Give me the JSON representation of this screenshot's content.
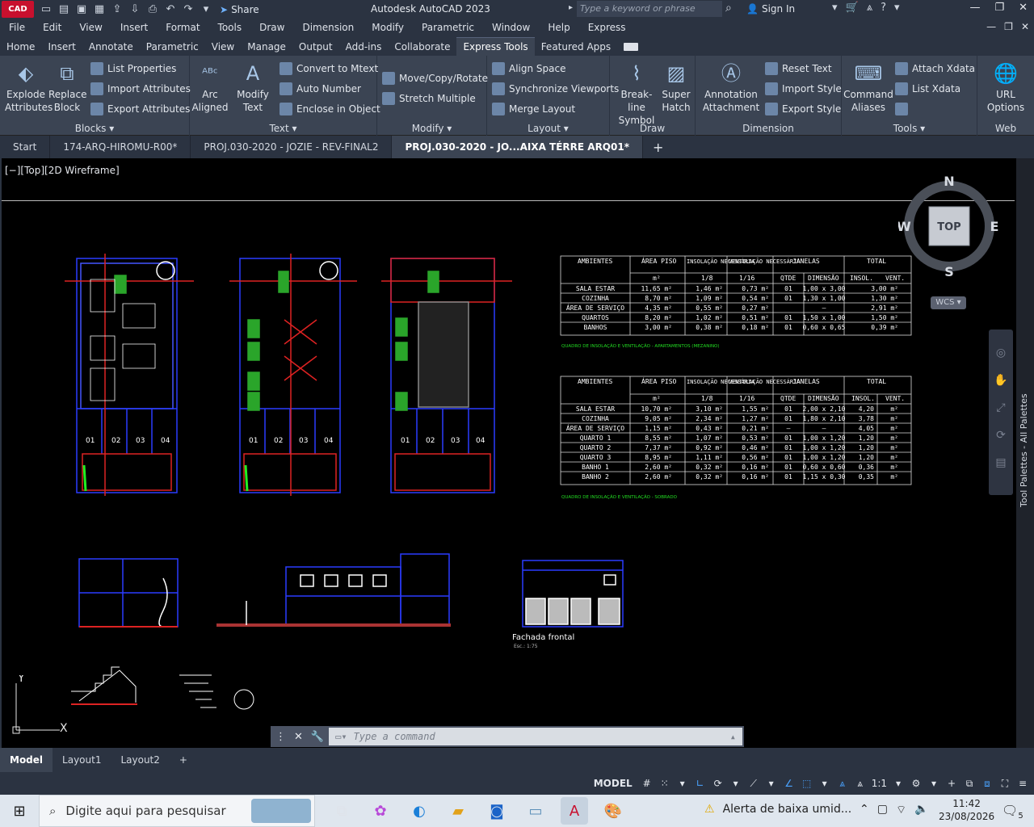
{
  "titlebar": {
    "app_badge": "CAD",
    "share_label": "Share",
    "title": "Autodesk AutoCAD 2023",
    "search_placeholder": "Type a keyword or phrase",
    "sign_in": "Sign In"
  },
  "menu": [
    "File",
    "Edit",
    "View",
    "Insert",
    "Format",
    "Tools",
    "Draw",
    "Dimension",
    "Modify",
    "Parametric",
    "Window",
    "Help",
    "Express"
  ],
  "ribbon_tabs": [
    "Home",
    "Insert",
    "Annotate",
    "Parametric",
    "View",
    "Manage",
    "Output",
    "Add-ins",
    "Collaborate",
    "Express Tools",
    "Featured Apps"
  ],
  "ribbon": {
    "blocks": {
      "title": "Blocks",
      "explode": "Explode Attributes",
      "replace": "Replace Block",
      "list_props": "List Properties",
      "import_attr": "Import Attributes",
      "export_attr": "Export Attributes"
    },
    "text": {
      "title": "Text",
      "arc": "Arc Aligned",
      "modify": "Modify Text",
      "convert": "Convert to Mtext",
      "autonum": "Auto Number",
      "enclose": "Enclose in Object"
    },
    "modify": {
      "title": "Modify",
      "move": "Move/Copy/Rotate",
      "stretch": "Stretch Multiple"
    },
    "layout": {
      "title": "Layout",
      "align": "Align Space",
      "sync": "Synchronize Viewports",
      "merge": "Merge Layout"
    },
    "draw": {
      "title": "Draw",
      "breakline": "Break-line Symbol",
      "superhatch": "Super Hatch"
    },
    "dimension": {
      "title": "Dimension",
      "annotation": "Annotation Attachment",
      "reset": "Reset Text",
      "import_style": "Import Style",
      "export_style": "Export Style"
    },
    "tools": {
      "title": "Tools",
      "command": "Command Aliases",
      "attach": "Attach Xdata",
      "list": "List Xdata"
    },
    "web": {
      "title": "Web",
      "url": "URL Options"
    }
  },
  "doc_tabs": [
    "Start",
    "174-ARQ-HIROMU-R00*",
    "PROJ.030-2020 - JOZIE - REV-FINAL2",
    "PROJ.030-2020 - JO...AIXA TÉRRE ARQ01*"
  ],
  "viewport_label": "[−][Top][2D Wireframe]",
  "viewcube": {
    "n": "N",
    "s": "S",
    "e": "E",
    "w": "W",
    "face": "TOP",
    "wcs": "WCS"
  },
  "tool_palettes": "Tool Palettes - All Palettes",
  "table1": {
    "headers": [
      "AMBIENTES",
      "ÁREA PISO",
      "INSOLAÇÃO NECESSÁRIA",
      "VENTILAÇÃO NECESSÁRIA",
      "JANELAS",
      "TOTAL"
    ],
    "sub": [
      "m²",
      "1/8",
      "1/16",
      "QTDE",
      "DIMENSÃO",
      "INSOL.",
      "VENT."
    ],
    "rows": [
      [
        "SALA ESTAR",
        "11,65 m²",
        "1,46 m²",
        "0,73 m²",
        "01",
        "1,00 x 3,00",
        "3,00 m²"
      ],
      [
        "COZINHA",
        "8,70 m²",
        "1,09 m²",
        "0,54 m²",
        "01",
        "1,30 x 1,00",
        "1,30 m²"
      ],
      [
        "ÁREA DE SERVIÇO",
        "4,35 m²",
        "0,55 m²",
        "0,27 m²",
        "",
        "–",
        "2,91 m²"
      ],
      [
        "QUARTOS",
        "8,20 m²",
        "1,02 m²",
        "0,51 m²",
        "01",
        "1,50 x 1,00",
        "1,50 m²"
      ],
      [
        "BANHOS",
        "3,00 m²",
        "0,38 m²",
        "0,18 m²",
        "01",
        "0,60 x 0,65",
        "0,39 m²"
      ]
    ],
    "caption": "QUADRO DE INSOLAÇÃO E VENTILAÇÃO - APARTAMENTOS (MEZANINO)"
  },
  "table2": {
    "headers": [
      "AMBIENTES",
      "ÁREA PISO",
      "INSOLAÇÃO NECESSÁRIA",
      "VENTILAÇÃO NECESSÁRIA",
      "JANELAS",
      "TOTAL"
    ],
    "sub": [
      "m²",
      "1/8",
      "1/16",
      "QTDE",
      "DIMENSÃO",
      "INSOL.",
      "VENT."
    ],
    "rows": [
      [
        "SALA ESTAR",
        "10,70 m²",
        "3,10 m²",
        "1,55 m²",
        "01",
        "2,00 x 2,10",
        "4,20",
        "m²"
      ],
      [
        "COZINHA",
        "9,05 m²",
        "2,34 m²",
        "1,27 m²",
        "01",
        "1,80 x 2,10",
        "3,78",
        "m²"
      ],
      [
        "ÁREA DE SERVIÇO",
        "1,15 m²",
        "0,43 m²",
        "0,21 m²",
        "–",
        "–",
        "4,05",
        "m²"
      ],
      [
        "QUARTO 1",
        "8,55 m²",
        "1,07 m²",
        "0,53 m²",
        "01",
        "1,00 x 1,20",
        "1,20",
        "m²"
      ],
      [
        "QUARTO 2",
        "7,37 m²",
        "0,92 m²",
        "0,46 m²",
        "01",
        "1,00 x 1,20",
        "1,20",
        "m²"
      ],
      [
        "QUARTO 3",
        "8,95 m²",
        "1,11 m²",
        "0,56 m²",
        "01",
        "1,00 x 1,20",
        "1,20",
        "m²"
      ],
      [
        "BANHO 1",
        "2,60 m²",
        "0,32 m²",
        "0,16 m²",
        "01",
        "0,60 x 0,60",
        "0,36",
        "m²"
      ],
      [
        "BANHO 2",
        "2,60 m²",
        "0,32 m²",
        "0,16 m²",
        "01",
        "1,15 x 0,30",
        "0,35",
        "m²"
      ]
    ],
    "caption": "QUADRO DE INSOLAÇÃO E VENTILAÇÃO - SOBRADO"
  },
  "plan_labels": [
    "01",
    "02",
    "03",
    "04"
  ],
  "facade_label": "Fachada frontal",
  "facade_scale": "Esc.: 1:75",
  "ucs": {
    "x": "X",
    "y": "Y"
  },
  "command_placeholder": "Type a command",
  "layout_tabs": [
    "Model",
    "Layout1",
    "Layout2"
  ],
  "status": {
    "model": "MODEL",
    "scale": "1:1"
  },
  "taskbar": {
    "search_placeholder": "Digite aqui para pesquisar",
    "alert": "Alerta de baixa umid...",
    "time": "11:42",
    "date": "23/08/2026",
    "notif_count": "5"
  }
}
